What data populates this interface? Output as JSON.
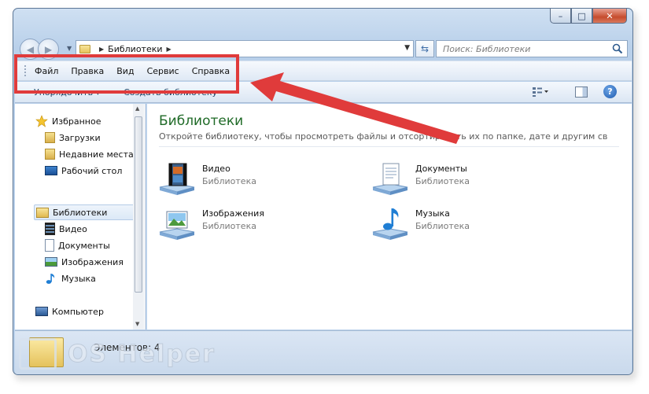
{
  "window": {
    "caption": {
      "minimize": "–",
      "maximize": "□",
      "close": "✕"
    }
  },
  "address": {
    "location": "Библиотеки"
  },
  "search": {
    "placeholder": "Поиск: Библиотеки"
  },
  "menubar": {
    "items": [
      "Файл",
      "Правка",
      "Вид",
      "Сервис",
      "Справка"
    ]
  },
  "toolbar": {
    "organize": "Упорядочить ▾",
    "create_library": "Создать библиотеку"
  },
  "navpane": {
    "favorites": {
      "label": "Избранное",
      "items": [
        "Загрузки",
        "Недавние места",
        "Рабочий стол"
      ]
    },
    "libraries": {
      "label": "Библиотеки",
      "items": [
        "Видео",
        "Документы",
        "Изображения",
        "Музыка"
      ]
    },
    "computer": {
      "label": "Компьютер"
    }
  },
  "content": {
    "title": "Библиотеки",
    "subtitle": "Откройте библиотеку, чтобы просмотреть файлы и отсортировать их по папке, дате и другим свойс...",
    "libraries": [
      {
        "name": "Видео",
        "type": "Библиотека",
        "icon": "video-library-icon"
      },
      {
        "name": "Документы",
        "type": "Библиотека",
        "icon": "documents-library-icon"
      },
      {
        "name": "Изображения",
        "type": "Библиотека",
        "icon": "pictures-library-icon"
      },
      {
        "name": "Музыка",
        "type": "Библиотека",
        "icon": "music-library-icon"
      }
    ]
  },
  "statusbar": {
    "count_text": "Элементов: 4"
  },
  "watermark": {
    "text": "OS Helper"
  },
  "colors": {
    "annotation": "#e03b3b",
    "title_green": "#1f6a27",
    "frame_blue": "#b9d0ea"
  }
}
